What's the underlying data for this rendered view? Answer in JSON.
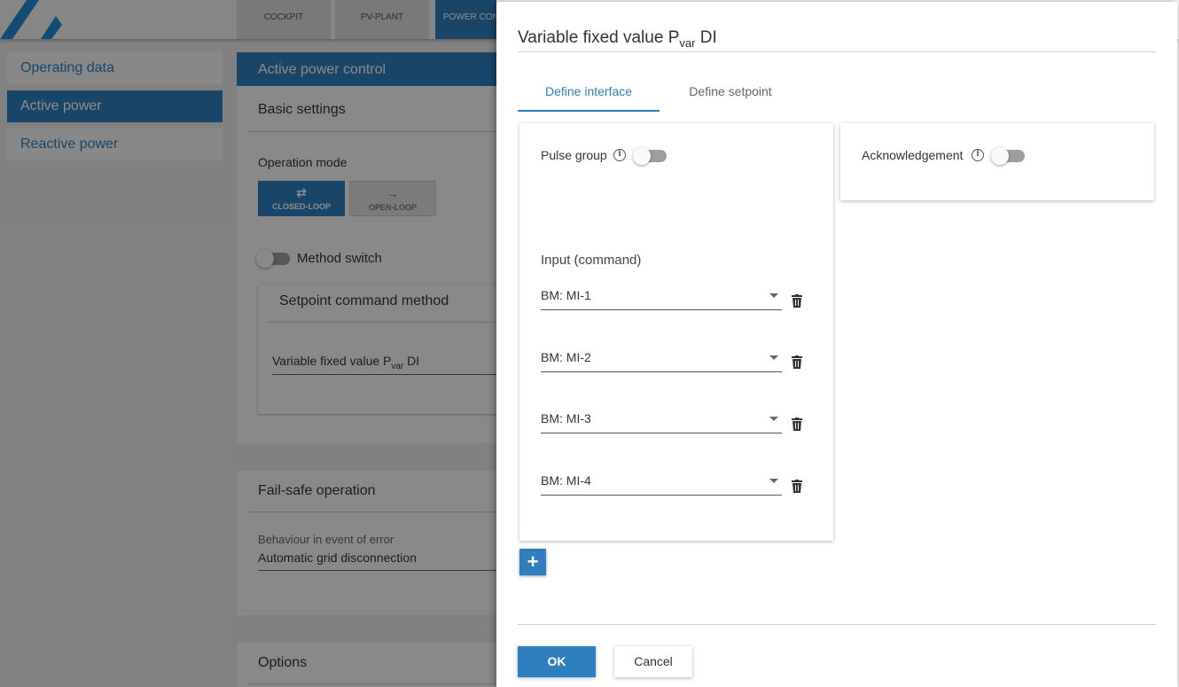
{
  "nav": {
    "tabs": [
      {
        "label": "COCKPIT"
      },
      {
        "label": "PV-PLANT"
      },
      {
        "label": "POWER CON"
      }
    ]
  },
  "sidebar": {
    "items": [
      {
        "label": "Operating data"
      },
      {
        "label": "Active power"
      },
      {
        "label": "Reactive power"
      }
    ]
  },
  "main": {
    "panel_title": "Active power control",
    "basic_settings": "Basic settings",
    "operation_mode_label": "Operation mode",
    "closed_loop_label": "CLOSED-LOOP",
    "open_loop_label": "OPEN-LOOP",
    "method_switch_label": "Method switch",
    "setpoint_command_method": "Setpoint command method",
    "variable_value_main": "Variable fixed value P",
    "variable_value_sub": "var",
    "variable_value_suffix": " DI",
    "fail_safe_title": "Fail-safe operation",
    "behaviour_label": "Behaviour in event of error",
    "behaviour_value": "Automatic grid disconnection",
    "options_title": "Options"
  },
  "dialog": {
    "title_main": "Variable fixed value P",
    "title_sub": "var",
    "title_suffix": " DI",
    "tabs": [
      {
        "label": "Define interface"
      },
      {
        "label": "Define setpoint"
      }
    ],
    "pulse_group_label": "Pulse group",
    "acknowledgement_label": "Acknowledgement",
    "input_command_label": "Input (command)",
    "inputs": [
      {
        "value": "BM: MI-1"
      },
      {
        "value": "BM: MI-2"
      },
      {
        "value": "BM: MI-3"
      },
      {
        "value": "BM: MI-4"
      }
    ],
    "add_label": "+",
    "ok_label": "OK",
    "cancel_label": "Cancel"
  },
  "colors": {
    "accent": "#2f7fbf"
  }
}
